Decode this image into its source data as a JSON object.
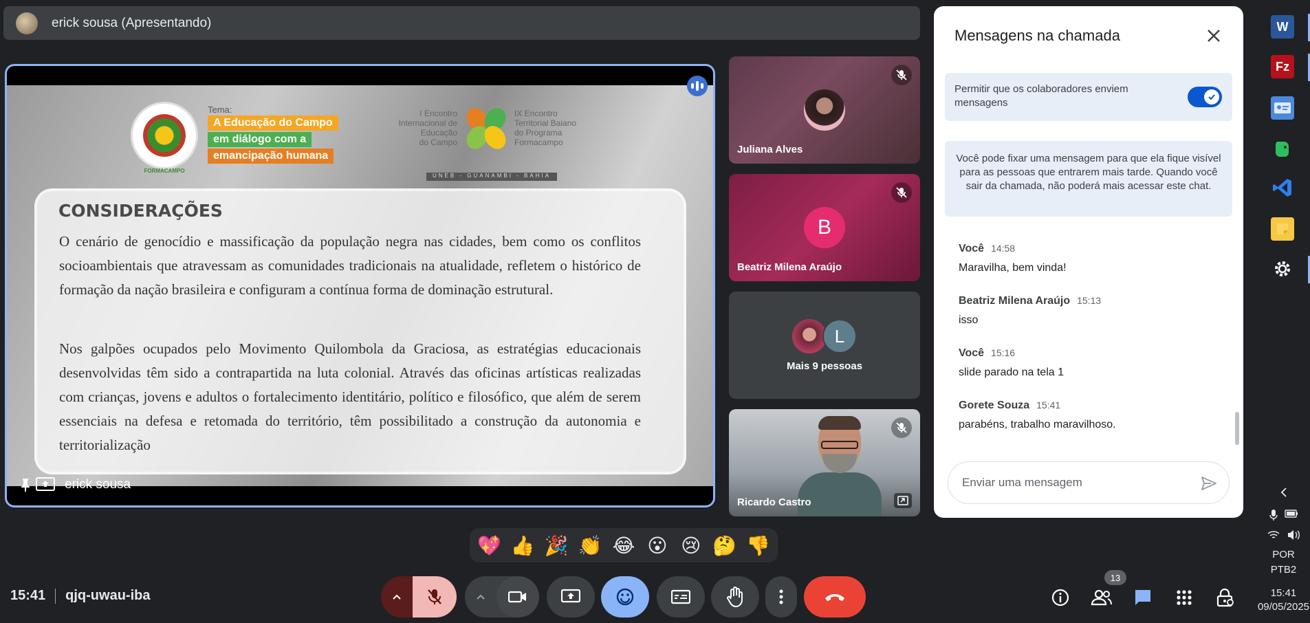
{
  "presenter_bar": {
    "label": "erick sousa (Apresentando)"
  },
  "slide": {
    "theme_label": "Tema:",
    "theme_lines": [
      "A Educação do Campo",
      "em diálogo com a",
      "emancipação humana"
    ],
    "logo_caption": "FORMACAMPO",
    "event_left": [
      "I Encontro",
      "Internacional de",
      "Educação",
      "do Campo"
    ],
    "event_right": [
      "IX Encontro",
      "Territorial Baiano",
      "do Programa",
      "Formacampo"
    ],
    "event_footer": "UNEB - GUANAMBI - BAHIA",
    "title": "CONSIDERAÇÕES",
    "paragraph1": "O cenário de genocídio e massificação da população negra nas cidades, bem como os conflitos socioambientais que atravessam as comunidades tradicionais na atualidade, refletem o histórico de formação da nação brasileira e configuram a contínua forma de dominação estrutural.",
    "paragraph2": "Nos galpões ocupados pelo Movimento Quilombola da Graciosa, as estratégias educacionais desenvolvidas têm sido a contrapartida na luta colonial. Através das oficinas artísticas realizadas com crianças, jovens e adultos o fortalecimento identitário, político e filosófico, que além de serem essenciais na defesa e retomada do território, têm possibilitado a construção da autonomia e territorialização"
  },
  "stage": {
    "presenter_label": "erick sousa"
  },
  "tiles": {
    "t1": {
      "name": "Juliana Alves"
    },
    "t2": {
      "name": "Beatriz Milena Araújo",
      "initial": "B"
    },
    "t3": {
      "label": "Mais 9 pessoas",
      "initial": "L"
    },
    "t4": {
      "name": "Ricardo Castro"
    }
  },
  "chat": {
    "title": "Mensagens na chamada",
    "allow_text": "Permitir que os colaboradores enviem mensagens",
    "allow_enabled": true,
    "info_text": "Você pode fixar uma mensagem para que ela fique visível para as pessoas que entrarem mais tarde. Quando você sair da chamada, não poderá mais acessar este chat.",
    "messages": [
      {
        "sender": "Você",
        "time": "14:58",
        "text": "Maravilha, bem vinda!"
      },
      {
        "sender": "Beatriz Milena Araújo",
        "time": "15:13",
        "text": "isso"
      },
      {
        "sender": "Você",
        "time": "15:16",
        "text": "slide parado na tela 1"
      },
      {
        "sender": "Gorete Souza",
        "time": "15:41",
        "text": "parabéns, trabalho maravilhoso."
      }
    ],
    "input_placeholder": "Enviar uma mensagem"
  },
  "reactions": [
    "💖",
    "👍",
    "🎉",
    "👏",
    "😂",
    "😮",
    "😢",
    "🤔",
    "👎"
  ],
  "meeting": {
    "time": "15:41",
    "code": "qjq-uwau-iba"
  },
  "people_count": "13",
  "taskbar": {
    "word_letter": "W",
    "fz_letter": "Fz",
    "lang1": "POR",
    "lang2": "PTB2",
    "clock_time": "15:41",
    "clock_date": "09/05/2025"
  },
  "colors": {
    "accent": "#8ab4f8",
    "leave": "#ea4335",
    "mic_off": "#f2b8b5",
    "toggle": "#0b57d0"
  }
}
